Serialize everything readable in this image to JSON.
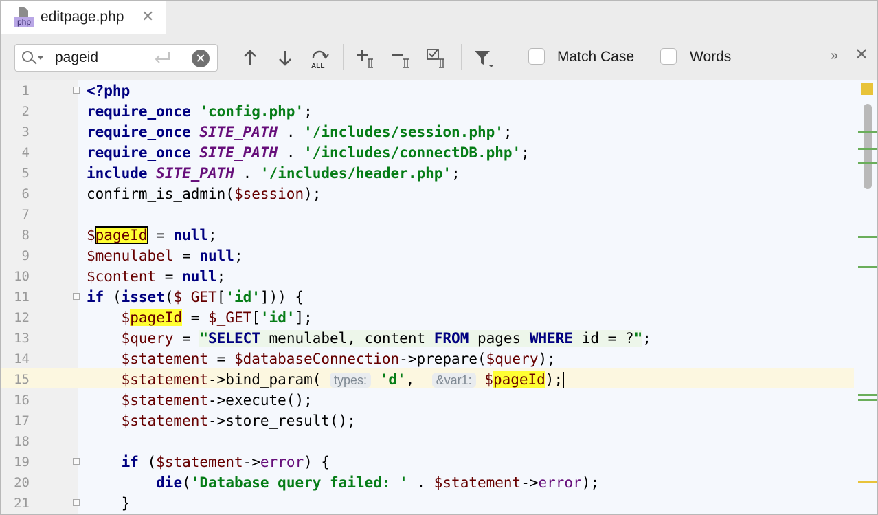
{
  "tab": {
    "icon_label": "php",
    "title": "editpage.php"
  },
  "find": {
    "query": "pageid",
    "all_label": "ALL",
    "match_case_label": "Match Case",
    "words_label": "Words",
    "more_label": "»",
    "close_label": "✕"
  },
  "editor": {
    "line_numbers": [
      "1",
      "2",
      "3",
      "4",
      "5",
      "6",
      "7",
      "8",
      "9",
      "10",
      "11",
      "12",
      "13",
      "14",
      "15",
      "16",
      "17",
      "18",
      "19",
      "20",
      "21"
    ],
    "caret_line": 15,
    "hints": {
      "types": "types:",
      "var1": "&var1:"
    }
  },
  "colors": {
    "keyword": "#000080",
    "constant": "#660e7a",
    "string": "#067d17",
    "variable": "#660000",
    "match_highlight": "#ffff33",
    "caret_row": "#fcf7e0"
  }
}
